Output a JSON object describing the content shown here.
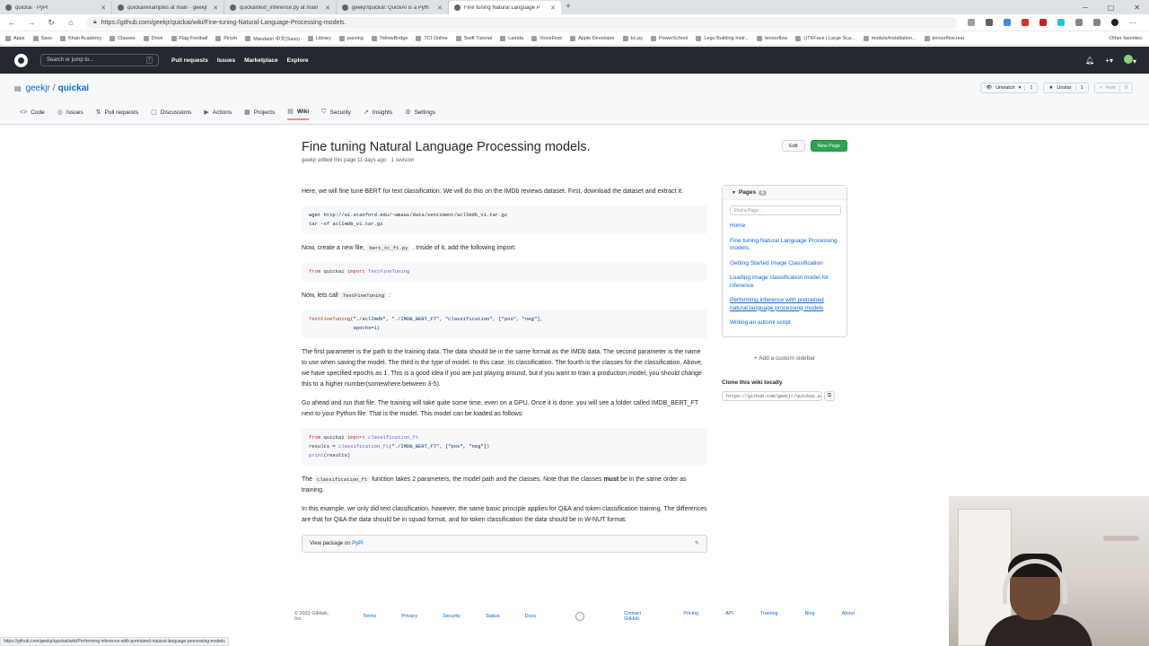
{
  "browser": {
    "tabs": [
      {
        "title": "quickai · PyPI",
        "active": false
      },
      {
        "title": "quickai/examples at main · geekjr",
        "active": false
      },
      {
        "title": "quickai/text_inference.py at main",
        "active": false
      },
      {
        "title": "geekjr/quickai: QuickAI is a Pyth",
        "active": false
      },
      {
        "title": "Fine tuning Natural Language P",
        "active": true
      }
    ],
    "url": "https://github.com/geekjr/quickai/wiki/Fine-tuning-Natural-Language-Processing-models.",
    "bookmarks": [
      "Apps",
      "Saxo",
      "Khan Academy",
      "Classes",
      "Drive",
      "Flag Football",
      "Pinyin",
      "Mandarin 中文(Saxo)",
      "Library",
      "parsing",
      "YellowBridge",
      "TCI Online",
      "Swift Tutorial",
      "Lamda",
      "VoiceFlow",
      "Apple Developer",
      "bc.py",
      "PowerSchool",
      "Lego Building Instr...",
      "tensorflow",
      "UTKFace | Large Sca...",
      "models/installation...",
      "tensorflow.real"
    ],
    "other_favorites": "Other favorites",
    "status_url": "https://github.com/geekjr/quickai/wiki/Performing-inference-with-pretrained-natural-language-processing-models"
  },
  "gh_header": {
    "search_placeholder": "Search or jump to...",
    "search_key": "/",
    "nav": [
      "Pull requests",
      "Issues",
      "Marketplace",
      "Explore"
    ]
  },
  "repo": {
    "owner": "geekjr",
    "name": "quickai",
    "separator": "/",
    "watch_label": "Unwatch",
    "watch_count": "1",
    "star_label": "Unstar",
    "star_count": "1",
    "fork_label": "Fork",
    "fork_count": "0",
    "tabs": [
      {
        "label": "Code",
        "icon": "<>"
      },
      {
        "label": "Issues",
        "icon": "◎"
      },
      {
        "label": "Pull requests",
        "icon": "⇅"
      },
      {
        "label": "Discussions",
        "icon": "▢"
      },
      {
        "label": "Actions",
        "icon": "▶"
      },
      {
        "label": "Projects",
        "icon": "▦"
      },
      {
        "label": "Wiki",
        "icon": "▤"
      },
      {
        "label": "Security",
        "icon": "⛉"
      },
      {
        "label": "Insights",
        "icon": "↗"
      },
      {
        "label": "Settings",
        "icon": "⚙"
      }
    ],
    "active_tab": "Wiki"
  },
  "page": {
    "title": "Fine tuning Natural Language Processing models.",
    "meta": "geekjr edited this page 11 days ago · 1 revision",
    "edit_label": "Edit",
    "new_page_label": "New Page",
    "p1": "Here, we will fine tune BERT for text classification. We will do this on the IMDb reviews dataset. First, download the dataset and extract it:",
    "code1_line1": "wget http://ai.stanford.edu/~amaas/data/sentiment/aclImdb_v1.tar.gz",
    "code1_line2": "tar -xf aclImdb_v1.tar.gz",
    "p2_before": "Now, create a new file, ",
    "p2_code": "bert_tc_ft.py",
    "p2_after": " . Inside of it, add the following import:",
    "code2_from": "from",
    "code2_module": " quickai ",
    "code2_import": "import",
    "code2_name": " TextFineTuning",
    "p3_before": "Now, lets call ",
    "p3_code": "TextFineTuning",
    "p3_after": " :",
    "code3_fn": "TextFineTuning",
    "code3_args": "(\"./aclImdb\", \"./IMDB_BERT_FT\", \"classification\", [\"pos\", \"neg\"],",
    "code3_line2": "               epochs=1)",
    "p4": "The first parameter is the path to the training data. The data should be in the same format as the IMDb data. The second parameter is the name to use when saving the model. The third is the type of model. In this case, its classification. The fourth is the classes for the classification. Above, we have specified epochs as 1. This is a good idea if you are just playing around, but if you want to train a production model, you should change this to a higher number(somewhere between 3-5).",
    "p5": "Go ahead and run that file. The training will take quite some time, even on a GPU. Once it is done. you will see a folder called IMDB_BERT_FT next to your Python file. That is the model. This model can be loaded as follows:",
    "code4_from": "from",
    "code4_module": " quickai ",
    "code4_import": "import",
    "code4_name": " classification_ft",
    "code4_line2_a": "results = ",
    "code4_line2_fn": "classification_ft",
    "code4_line2_b": "(\"./IMDB_BERT_FT\", [\"pos\", \"neg\"])",
    "code4_line3_fn": "print",
    "code4_line3_b": "(results)",
    "p6_before": "The ",
    "p6_code": "classification_ft",
    "p6_mid": " function takes 2 parameters, the model path and the classes. Note that the classes ",
    "p6_bold": "must",
    "p6_after": " be in the same order as training.",
    "p7": "In this example, we only did text classification, however, the same basic principle applies for Q&A and token classification training. The differences are that for Q&A the data should be in squad format, and for token classification the data should be in W-NUT format.",
    "footer_text": "View package on ",
    "footer_link": "PyPi"
  },
  "sidebar": {
    "pages_label": "Pages",
    "pages_count": "6",
    "filter_placeholder": "Find a Page...",
    "pages": [
      "Home",
      "Fine tuning Natural Language Processing models.",
      "Getting Started Image Classification",
      "Loading image classification model for inference",
      "Performing inference with pretrained natural language processing models",
      "Writing an automl script"
    ],
    "add_sidebar": "Add a custom sidebar",
    "clone_title": "Clone this wiki locally",
    "clone_url": "https://github.com/geekjr/quickai.wiki.git"
  },
  "footer": {
    "copyright": "© 2021 GitHub, Inc.",
    "left_links": [
      "Terms",
      "Privacy",
      "Security",
      "Status",
      "Docs"
    ],
    "right_links": [
      "Contact GitHub",
      "Pricing",
      "API",
      "Training",
      "Blog",
      "About"
    ]
  }
}
